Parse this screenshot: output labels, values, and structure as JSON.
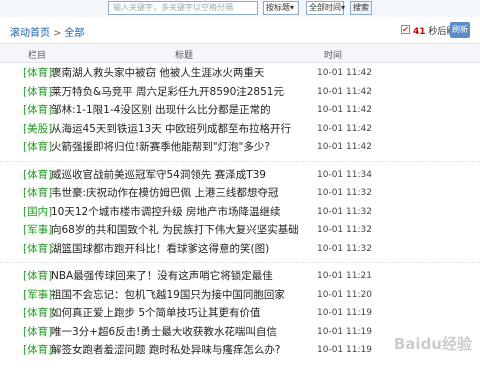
{
  "search": {
    "placeholder": "输入关键字，多关键字以空格分隔",
    "category_select": "按标题",
    "time_select": "全部时间",
    "search_button": "搜索"
  },
  "nav": {
    "home": "滚动首页",
    "separator": ">",
    "current": "全部"
  },
  "refresh": {
    "checked": "✔",
    "seconds": "41",
    "suffix": "秒后刷新",
    "button": "刷新"
  },
  "table": {
    "headers": [
      "栏目",
      "标题",
      "时间"
    ],
    "groups": [
      [
        {
          "col": "[体育]",
          "title": "褒南湖人救头家中被窃 他被人生涯冰火两重天",
          "time": "10-01 11:42"
        },
        {
          "col": "[体育]",
          "title": "莱万特负&马竞平 周六足彩任九开8590注2851元",
          "time": "10-01 11:42"
        },
        {
          "col": "[体育]",
          "title": "邹林:1-1限1-4没区别 出现什么比分都是正常的",
          "time": "10-01 11:42"
        },
        {
          "col": "[美股]",
          "title": "从海运45天到铁运13天 中欧班列成都至布拉格开行",
          "time": "10-01 11:42"
        },
        {
          "col": "[体育]",
          "title": "火箭强援即将归位!新赛季他能帮到\"灯泡\"多少?",
          "time": "10-01 11:42"
        }
      ],
      [
        {
          "col": "[体育]",
          "title": "威巡收官战前美巡冠军守54洞领先 赛泽成T39",
          "time": "10-01 11:34"
        },
        {
          "col": "[体育]",
          "title": "韦世豪:庆祝动作在模仿姆巴佩 上港三线都想夺冠",
          "time": "10-01 11:32"
        },
        {
          "col": "[国内]",
          "title": "10天12个城市楼市调控升级 房地产市场降温继续",
          "time": "10-01 11:32"
        },
        {
          "col": "[军事]",
          "title": "向68岁的共和国致个礼 为民族打下伟大复兴坚实基础",
          "time": "10-01 11:32"
        },
        {
          "col": "[体育]",
          "title": "湖篮国球都市跑开科比！看球爹这得意的笑(图)",
          "time": "10-01 11:32"
        }
      ],
      [
        {
          "col": "[体育]",
          "title": "NBA最强传球回来了！没有这声哨它将锁定最佳",
          "time": "10-01 11:21"
        },
        {
          "col": "[军事]",
          "title": "祖国不会忘记：包机飞越19国只为接中国同胞回家",
          "time": "10-01 11:20"
        },
        {
          "col": "[体育]",
          "title": "如何真正爱上跑步 5个简单技巧让其更有价值",
          "time": "10-01 11:19"
        },
        {
          "col": "[体育]",
          "title": "唯一3分+超6反击!勇士最大收获教水花喘叫自信",
          "time": "10-01 11:19"
        },
        {
          "col": "[体育]",
          "title": "解签女跑者羞涩问题 跑时私处异味与瘙痒怎么办?",
          "time": "10-01 11:19"
        }
      ]
    ]
  },
  "watermark": "Baidu经验"
}
